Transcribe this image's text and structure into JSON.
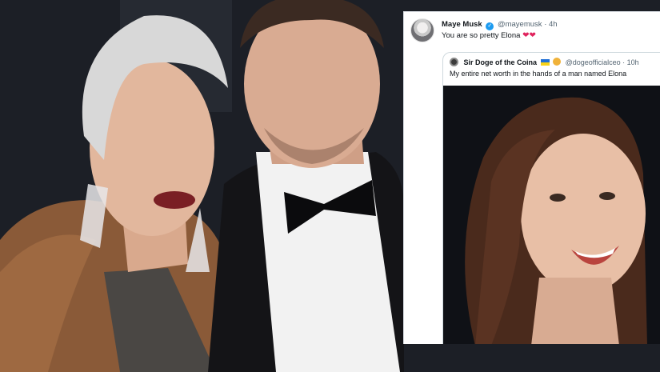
{
  "tweet": {
    "author_name": "Maye Musk",
    "author_handle": "@mayemusk",
    "time": "4h",
    "text": "You are so pretty Elona",
    "hearts": "❤❤"
  },
  "quoted_tweet": {
    "author_name": "Sir Doge of the Coina",
    "author_handle": "@dogeofficialceo",
    "time": "10h",
    "text": "My entire net worth in the hands of a man named Elona"
  },
  "colors": {
    "link_blue": "#1d9bf0",
    "heart_red": "#e0245e",
    "text_dark": "#0f1419",
    "text_muted": "#536471"
  }
}
